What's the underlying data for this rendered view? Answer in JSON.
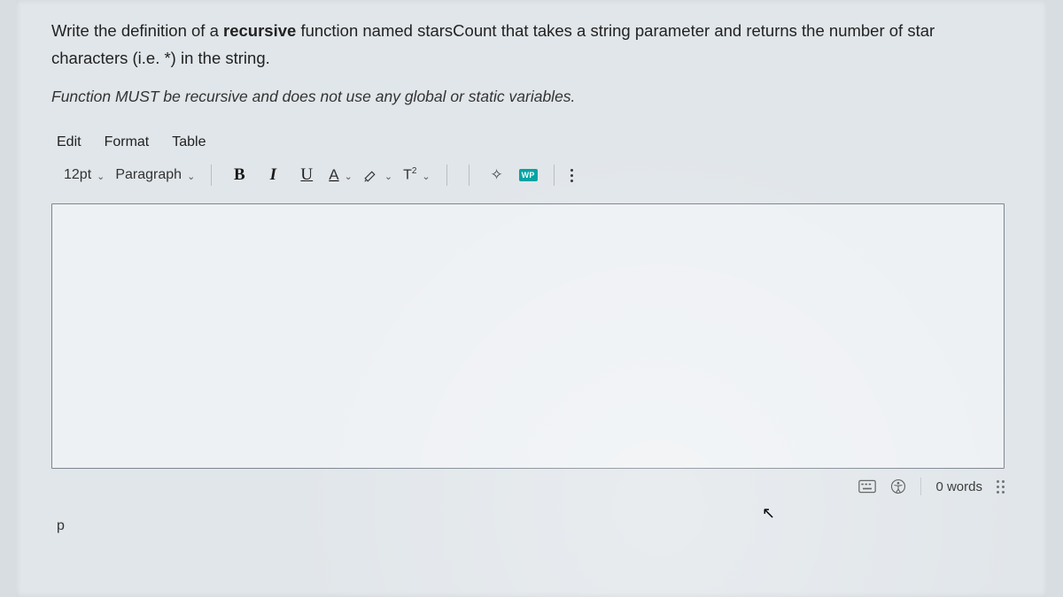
{
  "question": {
    "pre": "Write the definition of a ",
    "kw1": "recursive",
    "mid1": " function named ",
    "fn": "starsCount",
    "mid2": " that takes a string parameter and returns the ",
    "kw2": "number of star",
    "line2": "characters (i.e. *) in the string."
  },
  "instruction": "Function MUST be recursive and does not use any global or static variables.",
  "menubar": {
    "edit": "Edit",
    "format": "Format",
    "table": "Table"
  },
  "toolbar": {
    "fontsize": "12pt",
    "blocktype": "Paragraph",
    "bold": "B",
    "italic": "I",
    "underline": "U",
    "textcolor": "A",
    "superscript_base": "T",
    "superscript_exp": "2",
    "wp": "WP"
  },
  "status": {
    "words": "0 words"
  },
  "path": "p"
}
